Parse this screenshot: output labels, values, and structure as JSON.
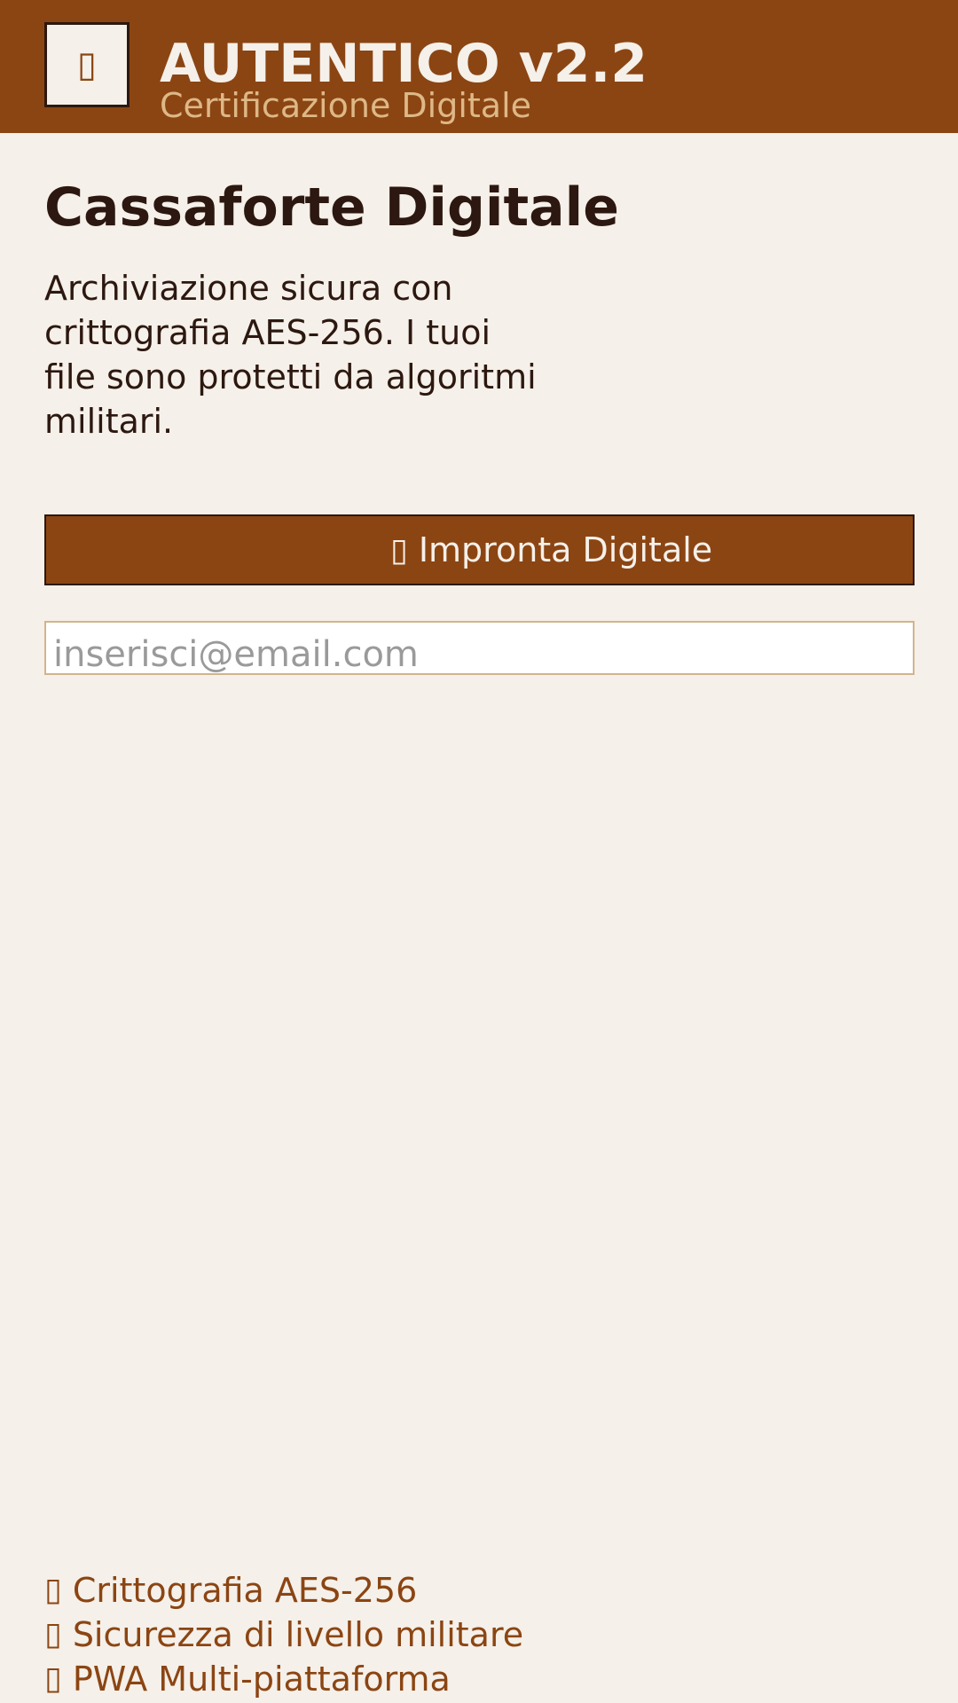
{
  "header": {
    "logo_icon": "▯",
    "title": "AUTENTICO v2.2",
    "subtitle": "Certificazione Digitale"
  },
  "main": {
    "title": "Cassaforte Digitale",
    "description": "Archiviazione sicura con crittografia AES-256. I tuoi file sono protetti da algoritmi militari.",
    "fingerprint_button": {
      "icon": "▯",
      "label": "Impronta Digitale"
    },
    "email_input": {
      "value": "",
      "placeholder": "inserisci@email.com"
    }
  },
  "features": [
    {
      "icon": "▯",
      "label": "Crittografia AES-256"
    },
    {
      "icon": "▯",
      "label": "Sicurezza di livello militare"
    },
    {
      "icon": "▯",
      "label": "PWA Multi-piattaforma"
    }
  ],
  "colors": {
    "brand": "#8b4513",
    "background": "#f5f0e9",
    "text_dark": "#2c1810",
    "accent_light": "#deb887",
    "input_border": "#d2b48c"
  }
}
